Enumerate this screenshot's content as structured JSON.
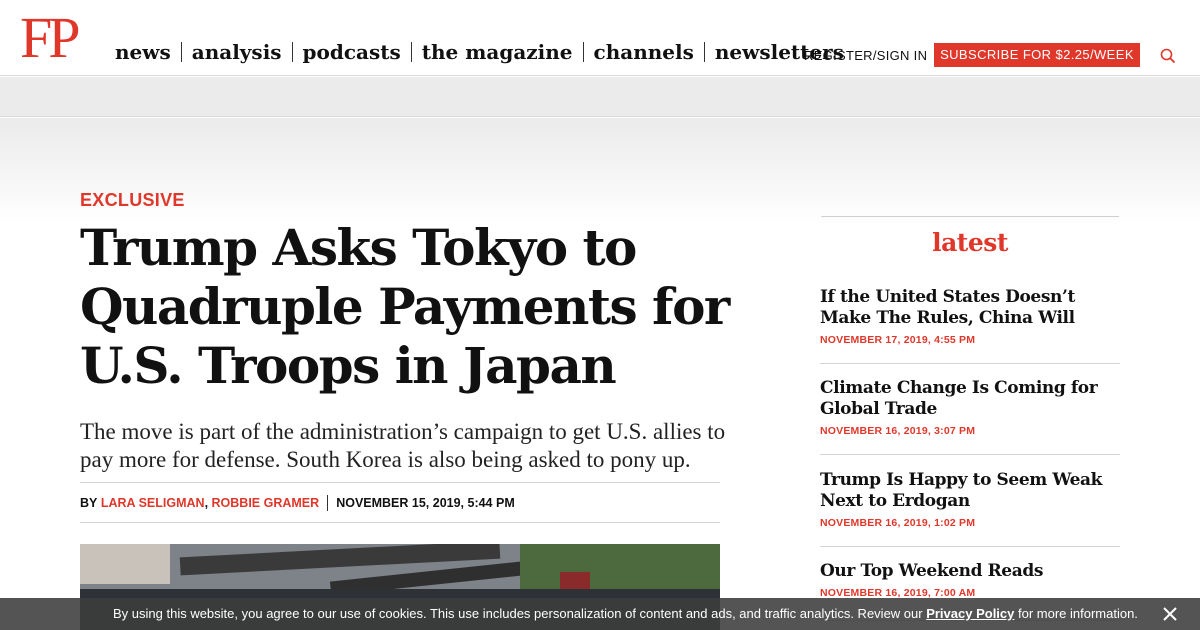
{
  "header": {
    "logo": "FP",
    "nav": [
      "news",
      "analysis",
      "podcasts",
      "the magazine",
      "channels",
      "newsletters"
    ],
    "register": "REGISTER/SIGN IN",
    "subscribe": "SUBSCRIBE FOR $2.25/WEEK",
    "search_icon": "search-icon"
  },
  "article": {
    "kicker": "EXCLUSIVE",
    "headline": "Trump Asks Tokyo to Quadruple Payments for U.S. Troops in Japan",
    "dek": "The move is part of the administration’s campaign to get U.S. allies to pay more for defense. South Korea is also being asked to pony up.",
    "byline": {
      "by": "BY",
      "authors": [
        "LARA SELIGMAN",
        "ROBBIE GRAMER"
      ],
      "separator": ",",
      "date": "NOVEMBER 15, 2019, 5:44 PM"
    }
  },
  "sidebar": {
    "heading": "latest",
    "stories": [
      {
        "title": "If the United States Doesn’t Make The Rules, China Will",
        "date": "NOVEMBER 17, 2019, 4:55 PM"
      },
      {
        "title": "Climate Change Is Coming for Global Trade",
        "date": "NOVEMBER 16, 2019, 3:07 PM"
      },
      {
        "title": "Trump Is Happy to Seem Weak Next to Erdogan",
        "date": "NOVEMBER 16, 2019, 1:02 PM"
      },
      {
        "title": "Our Top Weekend Reads",
        "date": "NOVEMBER 16, 2019, 7:00 AM"
      }
    ]
  },
  "cookie": {
    "text_before": "By using this website, you agree to our use of cookies. This use includes personalization of content and ads, and traffic analytics. Review our ",
    "link": "Privacy Policy",
    "text_after": " for more information.",
    "close_icon": "close-icon"
  },
  "colors": {
    "accent": "#e0372b",
    "text": "#111111",
    "band": "#ebebeb"
  }
}
